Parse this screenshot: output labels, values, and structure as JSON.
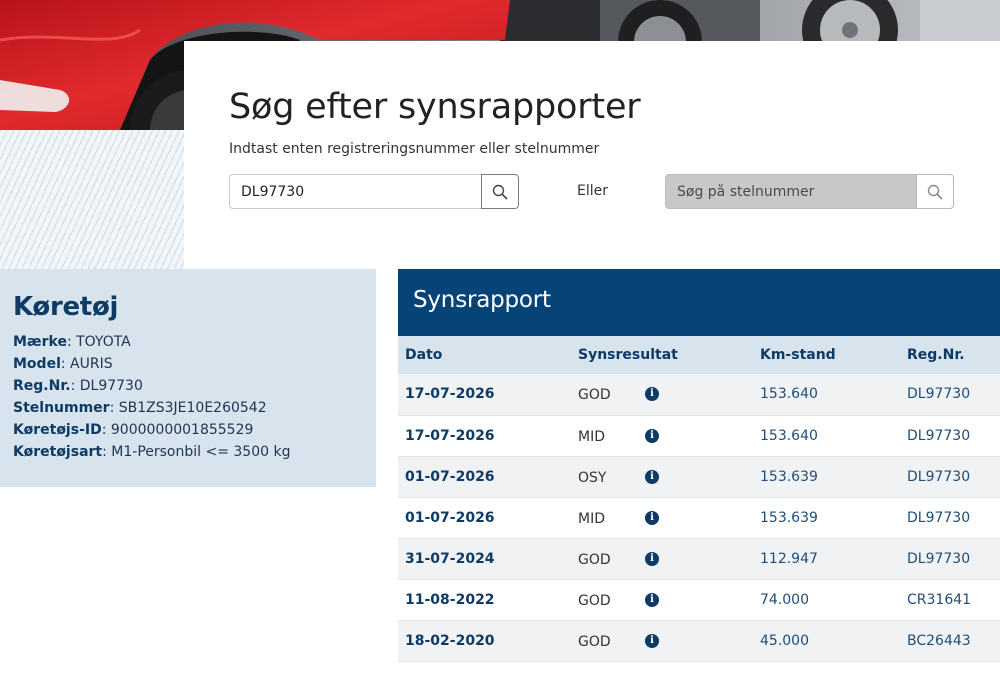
{
  "search": {
    "title": "Søg efter synsrapporter",
    "subtitle": "Indtast enten registreringsnummer eller stelnummer",
    "reg_value": "DL97730",
    "or_label": "Eller",
    "vin_placeholder": "Søg på stelnummer"
  },
  "vehicle": {
    "title": "Køretøj",
    "fields": [
      {
        "label": "Mærke",
        "value": "TOYOTA"
      },
      {
        "label": "Model",
        "value": "AURIS"
      },
      {
        "label": "Reg.Nr.",
        "value": "DL97730"
      },
      {
        "label": "Stelnummer",
        "value": "SB1ZS3JE10E260542"
      },
      {
        "label": "Køretøjs-ID",
        "value": "9000000001855529"
      },
      {
        "label": "Køretøjsart",
        "value": "M1-Personbil <= 3500 kg"
      }
    ]
  },
  "report": {
    "title": "Synsrapport",
    "columns": [
      "Dato",
      "Synsresultat",
      "Km-stand",
      "Reg.Nr."
    ],
    "rows": [
      {
        "date": "17-07-2026",
        "result": "GOD",
        "km": "153.640",
        "reg": "DL97730"
      },
      {
        "date": "17-07-2026",
        "result": "MID",
        "km": "153.640",
        "reg": "DL97730"
      },
      {
        "date": "01-07-2026",
        "result": "OSY",
        "km": "153.639",
        "reg": "DL97730"
      },
      {
        "date": "01-07-2026",
        "result": "MID",
        "km": "153.639",
        "reg": "DL97730"
      },
      {
        "date": "31-07-2024",
        "result": "GOD",
        "km": "112.947",
        "reg": "DL97730"
      },
      {
        "date": "11-08-2022",
        "result": "GOD",
        "km": "74.000",
        "reg": "CR31641"
      },
      {
        "date": "18-02-2020",
        "result": "GOD",
        "km": "45.000",
        "reg": "BC26443"
      }
    ]
  },
  "icons": {
    "search": "search-icon",
    "info": "info-icon"
  },
  "colors": {
    "brand_navy": "#064377",
    "panel_blue": "#d7e3ed",
    "car_red": "#d81f26"
  }
}
